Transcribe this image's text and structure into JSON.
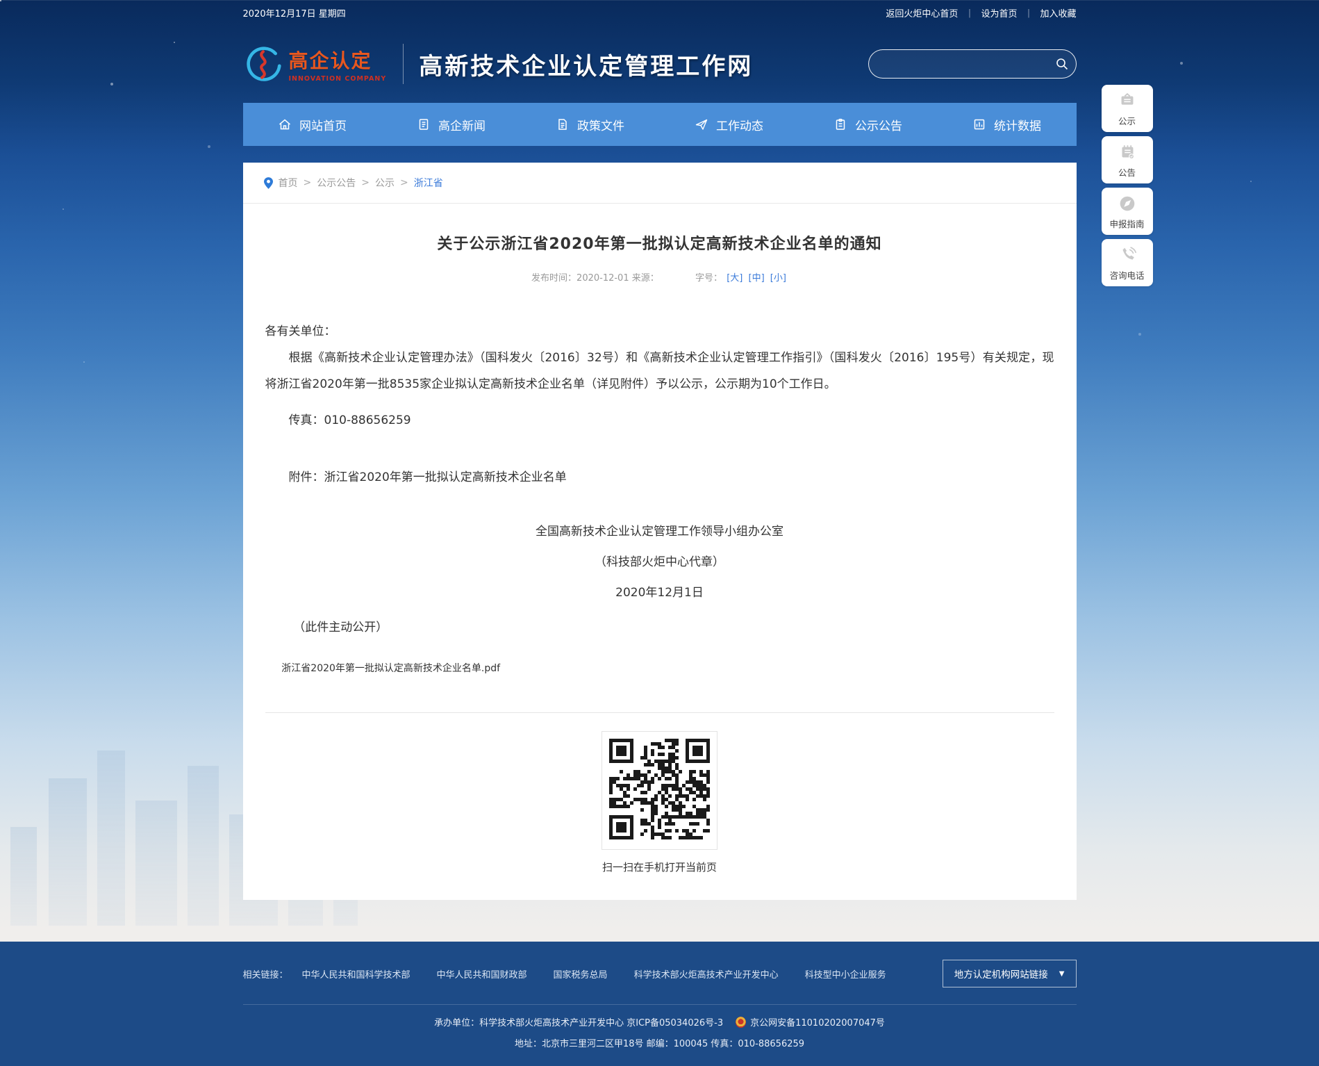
{
  "topbar": {
    "date": "2020年12月17日 星期四",
    "separator": "｜",
    "links": [
      "返回火炬中心首页",
      "设为首页",
      "加入收藏"
    ]
  },
  "header": {
    "logo_title": "高企认定",
    "logo_subtitle": "INNOVATION COMPANY",
    "site_title": "高新技术企业认定管理工作网"
  },
  "nav": {
    "items": [
      {
        "label": "网站首页",
        "icon": "home-icon"
      },
      {
        "label": "高企新闻",
        "icon": "news-icon"
      },
      {
        "label": "政策文件",
        "icon": "policy-doc-icon"
      },
      {
        "label": "工作动态",
        "icon": "paper-plane-icon"
      },
      {
        "label": "公示公告",
        "icon": "clipboard-icon"
      },
      {
        "label": "统计数据",
        "icon": "chart-icon"
      }
    ]
  },
  "side_float": {
    "items": [
      {
        "label": "公示",
        "icon": "notice-board-icon"
      },
      {
        "label": "公告",
        "icon": "announcement-pad-icon"
      },
      {
        "label": "申报指南",
        "icon": "compass-icon"
      },
      {
        "label": "咨询电话",
        "icon": "phone-icon"
      }
    ]
  },
  "breadcrumb": {
    "separator": ">",
    "items": [
      "首页",
      "公示公告",
      "公示",
      "浙江省"
    ]
  },
  "article": {
    "title": "关于公示浙江省2020年第一批拟认定高新技术企业名单的通知",
    "meta": {
      "publish_label": "发布时间：",
      "publish_date": "2020-12-01",
      "source_label": "来源：",
      "fontsize_label": "字号：",
      "sizes": [
        "[大]",
        "[中]",
        "[小]"
      ]
    },
    "salutation": "各有关单位：",
    "paragraph": "根据《高新技术企业认定管理办法》（国科发火〔2016〕32号）和《高新技术企业认定管理工作指引》（国科发火〔2016〕195号）有关规定，现将浙江省2020年第一批8535家企业拟认定高新技术企业名单（详见附件）予以公示，公示期为10个工作日。",
    "fax": "传真：010-88656259",
    "attachment": "附件：浙江省2020年第一批拟认定高新技术企业名单",
    "signer": "全国高新技术企业认定管理工作领导小组办公室",
    "signer_note": "（科技部火炬中心代章）",
    "sign_date": "2020年12月1日",
    "disclosure": "（此件主动公开）",
    "pdf_link": "浙江省2020年第一批拟认定高新技术企业名单.pdf",
    "qr_caption": "扫一扫在手机打开当前页"
  },
  "footer": {
    "related_label": "相关链接：",
    "links": [
      "中华人民共和国科学技术部",
      "中华人民共和国财政部",
      "国家税务总局",
      "科学技术部火炬高技术产业开发中心",
      "科技型中小企业服务"
    ],
    "dropdown_label": "地方认定机构网站链接",
    "dropdown_caret": "▼",
    "line1_part1": "承办单位：科学技术部火炬高技术产业开发中心 京ICP备05034026号-3",
    "line1_part2": "京公网安备11010202007047号",
    "line2": "地址：北京市三里河二区甲18号 邮编：100045 传真：010-88656259"
  },
  "colors": {
    "nav_blue": "#4a8ed8",
    "footer_blue": "#1d4b87",
    "link_blue": "#3a7ad9",
    "logo_orange": "#e8571f",
    "top_navy": "#092a5c"
  }
}
